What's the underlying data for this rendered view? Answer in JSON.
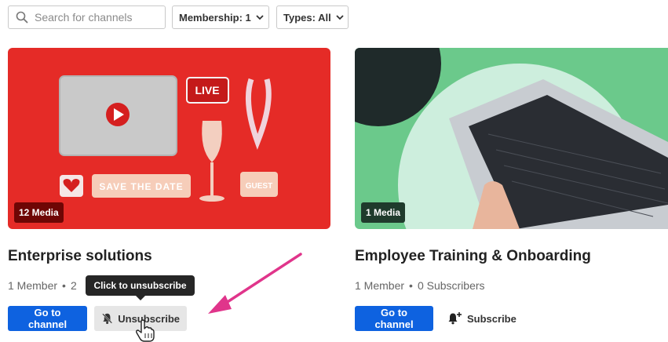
{
  "filters": {
    "search_placeholder": "Search for channels",
    "membership_label": "Membership: 1",
    "types_label": "Types: All"
  },
  "cards": [
    {
      "media_count": "12 Media",
      "title": "Enterprise solutions",
      "members": "1 Member",
      "subscribers": "2",
      "go_label": "Go to channel",
      "subscribe_label": "Unsubscribe",
      "thumb_text": {
        "live": "LIVE",
        "save_the_date": "SAVE THE DATE",
        "guest": "GUEST"
      }
    },
    {
      "media_count": "1 Media",
      "title": "Employee Training & Onboarding",
      "members": "1 Member",
      "subscribers": "0 Subscribers",
      "go_label": "Go to channel",
      "subscribe_label": "Subscribe"
    }
  ],
  "tooltip": "Click to unsubscribe",
  "colors": {
    "primary_button": "#0e62e0",
    "annotation_arrow": "#e0358b",
    "card1_bg": "#e52b27",
    "card2_bg": "#6bc98b"
  }
}
